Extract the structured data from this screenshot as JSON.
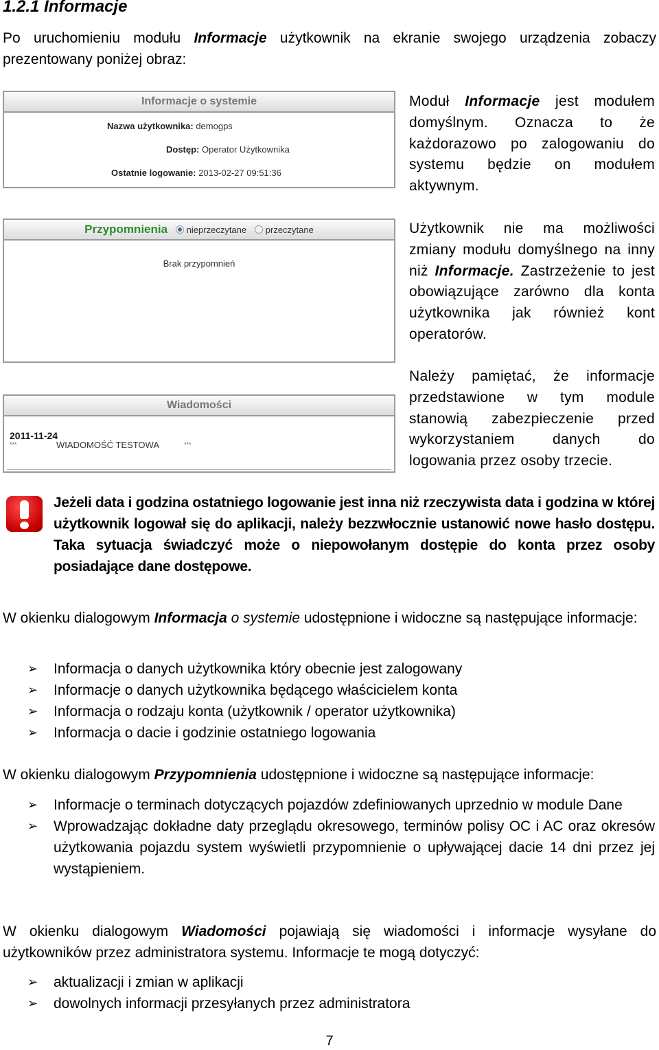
{
  "section": {
    "heading": "1.2.1 Informacje"
  },
  "intro": {
    "before": "Po uruchomieniu modułu ",
    "bold": "Informacje",
    "after": " użytkownik na ekranie swojego urządzenia zobaczy prezentowany poniżej obraz:"
  },
  "panels": {
    "info": {
      "title": "Informacje o systemie",
      "rows": [
        {
          "label": "Nazwa użytkownika:",
          "value": "demogps"
        },
        {
          "label": "Dostęp:",
          "value": "Operator Użytkownika"
        },
        {
          "label": "Ostatnie logowanie:",
          "value": "2013-02-27 09:51:36"
        }
      ]
    },
    "reminders": {
      "title": "Przypomnienia",
      "title_color": "#2e8b2e",
      "filters": [
        {
          "label": "nieprzeczytane",
          "selected": true
        },
        {
          "label": "przeczytane",
          "selected": false
        }
      ],
      "empty_text": "Brak przypomnień"
    },
    "messages": {
      "title": "Wiadomości",
      "items": [
        {
          "date": "2011-11-24",
          "marker_left": "***",
          "text": "WIADOMOŚĆ TESTOWA",
          "marker_right": "***"
        }
      ]
    }
  },
  "side_notes": {
    "note1": {
      "before": "Moduł ",
      "bold": "Informacje",
      "after": " jest modułem domyślnym. Oznacza to że każdorazowo po zalogowaniu do systemu będzie on modułem aktywnym."
    },
    "note2": {
      "before": "Użytkownik nie ma możliwości zmiany modułu domyślnego na inny niż ",
      "bold": "Informacje.",
      "after": " Zastrzeżenie to jest obowiązujące zarówno dla konta użytkownika jak również kont operatorów."
    },
    "note3": {
      "text": "Należy pamiętać, że informacje przedstawione w tym module stanowią zabezpieczenie przed wykorzystaniem danych do logowania przez osoby trzecie."
    }
  },
  "warning": {
    "icon": "exclamation-icon",
    "color": "#c80000",
    "text": "Jeżeli data i godzina ostatniego logowanie jest inna niż rzeczywista data i godzina w której użytkownik logował się do aplikacji, należy bezzwłocznie ustanowić nowe hasło dostępu. Taka sytuacja świadczyć może o niepowołanym dostępie do konta przez osoby posiadające dane dostępowe."
  },
  "sections": {
    "info_section": {
      "before": "W okienku dialogowym ",
      "bold": "Informacja",
      "italic": " o systemie",
      "after": " udostępnione i widoczne są następujące informacje:",
      "bullets": [
        "Informacja o danych użytkownika który obecnie jest zalogowany",
        "Informacje o danych użytkownika będącego właścicielem konta",
        "Informacja o rodzaju konta (użytkownik / operator użytkownika)",
        "Informacja o dacie i godzinie ostatniego logowania"
      ]
    },
    "reminders_section": {
      "before": "W okienku dialogowym ",
      "bold": "Przypomnienia",
      "after": " udostępnione i widoczne są następujące informacje:",
      "bullets": [
        "Informacje o terminach dotyczących pojazdów zdefiniowanych uprzednio w module Dane",
        "Wprowadzając dokładne daty przeglądu okresowego, terminów polisy OC i AC oraz okresów użytkowania pojazdu system wyświetli przypomnienie o upływającej dacie 14 dni przez jej wystąpieniem."
      ]
    },
    "messages_section": {
      "before": "W okienku dialogowym ",
      "bold": "Wiadomości",
      "after": " pojawiają się wiadomości i informacje wysyłane do użytkowników przez administratora systemu. Informacje te mogą dotyczyć:",
      "bullets": [
        "aktualizacji i zmian w aplikacji",
        "dowolnych informacji przesyłanych przez administratora"
      ]
    }
  },
  "bullet_glyph": "➢",
  "page_number": "7"
}
